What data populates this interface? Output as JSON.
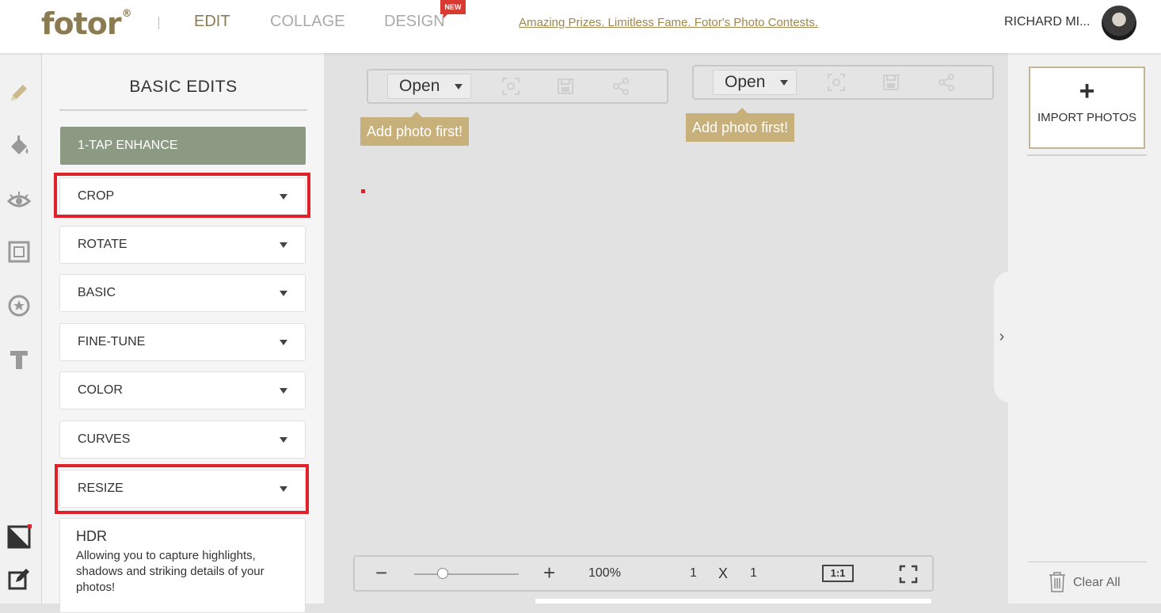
{
  "header": {
    "logo": "fotor",
    "logo_mark": "®",
    "nav": {
      "edit": "EDIT",
      "collage": "COLLAGE",
      "design": "DESIGN"
    },
    "new_badge": "NEW",
    "promo": "Amazing Prizes. Limitless Fame. Fotor's Photo Contests.",
    "user": "RICHARD MI..."
  },
  "rail": {
    "icons": [
      "pencil-icon",
      "paint-bucket-icon",
      "eye-icon",
      "frame-icon",
      "star-sticker-icon",
      "text-icon",
      "compare-icon",
      "edit-note-icon"
    ]
  },
  "panel": {
    "title": "BASIC EDITS",
    "enhance": "1-TAP ENHANCE",
    "items": [
      "CROP",
      "ROTATE",
      "BASIC",
      "FINE-TUNE",
      "COLOR",
      "CURVES",
      "RESIZE"
    ],
    "hdr": {
      "title": "HDR",
      "desc": "Allowing you to capture highlights, shadows and striking details of your photos!"
    }
  },
  "canvas": {
    "left": {
      "open": "Open",
      "tip": "Add photo first!"
    },
    "right": {
      "open": "Open",
      "tip": "Add photo first!"
    },
    "zoom": {
      "minus": "−",
      "plus": "+",
      "percent": "100%",
      "w": "1",
      "x": "X",
      "h": "1",
      "one_to_one": "1:1"
    },
    "collapse": "›"
  },
  "right_panel": {
    "import_plus": "+",
    "import_label": "IMPORT PHOTOS",
    "clear_all": "Clear All"
  },
  "colors": {
    "brand": "#8a7b52",
    "enhance": "#8c9a84",
    "tip": "#c8b07a",
    "highlight": "#e0202b"
  }
}
